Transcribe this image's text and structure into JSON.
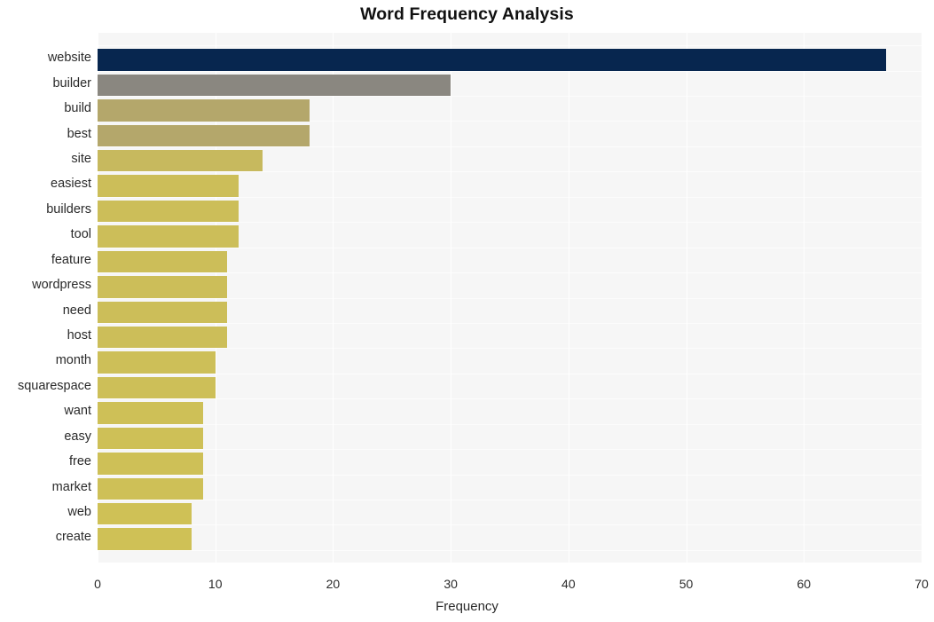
{
  "chart_data": {
    "type": "bar",
    "orientation": "horizontal",
    "title": "Word Frequency Analysis",
    "xlabel": "Frequency",
    "ylabel": "",
    "xlim": [
      0,
      70
    ],
    "xticks": [
      0,
      10,
      20,
      30,
      40,
      50,
      60,
      70
    ],
    "xtick_labels": [
      "0",
      "10",
      "20",
      "30",
      "40",
      "50",
      "60",
      "70"
    ],
    "grid": true,
    "legend": "none",
    "categories": [
      "website",
      "builder",
      "build",
      "best",
      "site",
      "easiest",
      "builders",
      "tool",
      "feature",
      "wordpress",
      "need",
      "host",
      "month",
      "squarespace",
      "want",
      "easy",
      "free",
      "market",
      "web",
      "create"
    ],
    "values": [
      67,
      30,
      18,
      18,
      14,
      12,
      12,
      12,
      11,
      11,
      11,
      11,
      10,
      10,
      9,
      9,
      9,
      9,
      8,
      8
    ],
    "bar_colors": [
      "#07264f",
      "#8a8780",
      "#b4a76b",
      "#b4a76b",
      "#c7b95e",
      "#ccbe59",
      "#ccbe59",
      "#ccbe59",
      "#ccbe59",
      "#ccbe59",
      "#ccbe59",
      "#ccbe59",
      "#cdbf58",
      "#cdbf58",
      "#cec057",
      "#cec057",
      "#cec057",
      "#cec057",
      "#cfc156",
      "#cfc156"
    ]
  },
  "style": {
    "plot_background": "#f6f6f6",
    "figure_background": "#ffffff",
    "gridline_color": "#ffffff",
    "text_color": "#2a2a2a",
    "title_color": "#111111"
  }
}
